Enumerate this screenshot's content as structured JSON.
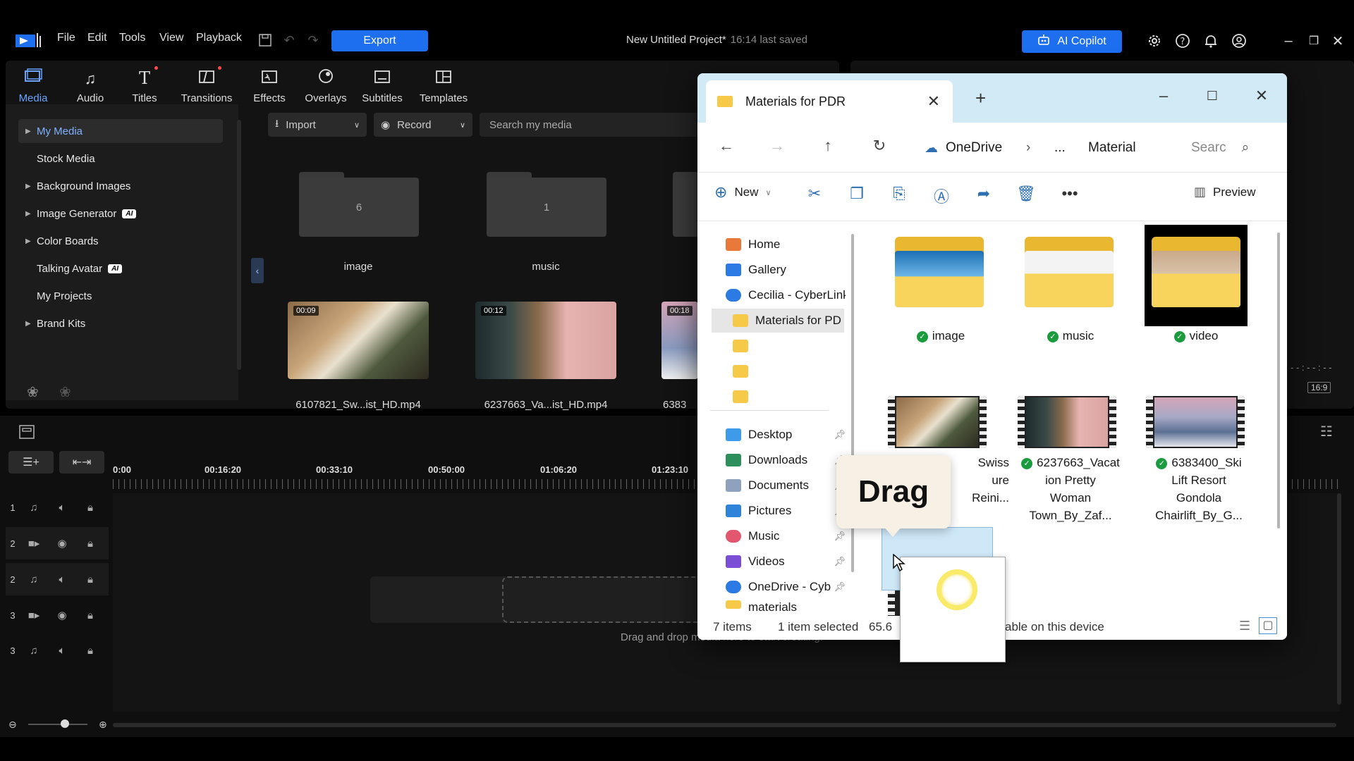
{
  "menubar": {
    "items": [
      "File",
      "Edit",
      "Tools",
      "View",
      "Playback"
    ],
    "export_label": "Export",
    "project_title": "New Untitled Project*",
    "saved_text": "16:14 last saved",
    "copilot_label": "AI Copilot"
  },
  "rooms": [
    {
      "label": "Media",
      "icon": "media-icon"
    },
    {
      "label": "Audio",
      "icon": "music-note-icon"
    },
    {
      "label": "Titles",
      "icon": "title-t-icon"
    },
    {
      "label": "Transitions",
      "icon": "transition-icon"
    },
    {
      "label": "Effects",
      "icon": "effects-icon"
    },
    {
      "label": "Overlays",
      "icon": "overlays-icon"
    },
    {
      "label": "Subtitles",
      "icon": "subtitles-icon"
    },
    {
      "label": "Templates",
      "icon": "templates-icon"
    }
  ],
  "tree": [
    {
      "label": "My Media",
      "arrow": true
    },
    {
      "label": "Stock Media",
      "arrow": false
    },
    {
      "label": "Background Images",
      "arrow": true
    },
    {
      "label": "Image Generator",
      "arrow": true,
      "badge": "AI"
    },
    {
      "label": "Color Boards",
      "arrow": true
    },
    {
      "label": "Talking Avatar",
      "arrow": false,
      "badge": "AI"
    },
    {
      "label": "My Projects",
      "arrow": false
    },
    {
      "label": "Brand Kits",
      "arrow": true
    }
  ],
  "library": {
    "import_label": "Import",
    "record_label": "Record",
    "search_placeholder": "Search my media",
    "folders": [
      {
        "count": "6",
        "label": "image"
      },
      {
        "count": "1",
        "label": "music"
      }
    ],
    "videos": [
      {
        "duration": "00:09",
        "label": "6107821_Sw...ist_HD.mp4"
      },
      {
        "duration": "00:12",
        "label": "6237663_Va...ist_HD.mp4"
      },
      {
        "duration": "00:18",
        "label": "6383"
      }
    ]
  },
  "preview": {
    "timecode": "- - : - - : - -",
    "ratio": "16:9"
  },
  "timeline": {
    "ruler": [
      "0:00",
      "00:16:20",
      "00:33:10",
      "00:50:00",
      "01:06:20",
      "01:23:10"
    ],
    "tracks": [
      {
        "num": "1",
        "type": "audio"
      },
      {
        "num": "2",
        "type": "video"
      },
      {
        "num": "2",
        "type": "audio"
      },
      {
        "num": "3",
        "type": "video"
      },
      {
        "num": "3",
        "type": "audio"
      }
    ],
    "drop_hint": "Drag and drop media here to start creating."
  },
  "explorer": {
    "tab_title": "Materials for PDR",
    "breadcrumb": [
      "OneDrive",
      "...",
      "Material"
    ],
    "search_placeholder": "Searc",
    "new_label": "New",
    "preview_label": "Preview",
    "nav": [
      {
        "label": "Home",
        "color": "#e8793a"
      },
      {
        "label": "Gallery",
        "color": "#2c7be5"
      },
      {
        "label": "Cecilia - CyberLink",
        "color": "#2c7be5"
      },
      {
        "label": "Materials for PD",
        "color": "#f7c948",
        "selected": true
      },
      {
        "label": "",
        "color": "#f7c948"
      },
      {
        "label": "",
        "color": "#f7c948"
      },
      {
        "label": "",
        "color": "#f7c948"
      }
    ],
    "quick": [
      {
        "label": "Desktop",
        "color": "#3d9be9"
      },
      {
        "label": "Downloads",
        "color": "#2d8f5b"
      },
      {
        "label": "Documents",
        "color": "#8fa2bd"
      },
      {
        "label": "Pictures",
        "color": "#2f83d8"
      },
      {
        "label": "Music",
        "color": "#e2566f"
      },
      {
        "label": "Videos",
        "color": "#7b4ed6"
      },
      {
        "label": "OneDrive - Cyb",
        "color": "#2c7be5"
      },
      {
        "label": "materials",
        "color": "#f7c948"
      }
    ],
    "files": [
      {
        "label": "image",
        "kind": "folder"
      },
      {
        "label": "music",
        "kind": "folder"
      },
      {
        "label": "video",
        "kind": "folder"
      },
      {
        "lines": [
          "Swiss",
          "ure",
          "Reini..."
        ],
        "kind": "video"
      },
      {
        "lines": [
          "6237663_Vacat",
          "ion Pretty",
          "Woman",
          "Town_By_Zaf..."
        ],
        "kind": "video"
      },
      {
        "lines": [
          "6383400_Ski",
          "Lift Resort",
          "Gondola",
          "Chairlift_By_G..."
        ],
        "kind": "video"
      }
    ],
    "status_items": "7 items",
    "status_selected": "1 item selected",
    "status_size": "65.6",
    "status_avail": "able on this device"
  },
  "drag": {
    "label": "Drag"
  }
}
